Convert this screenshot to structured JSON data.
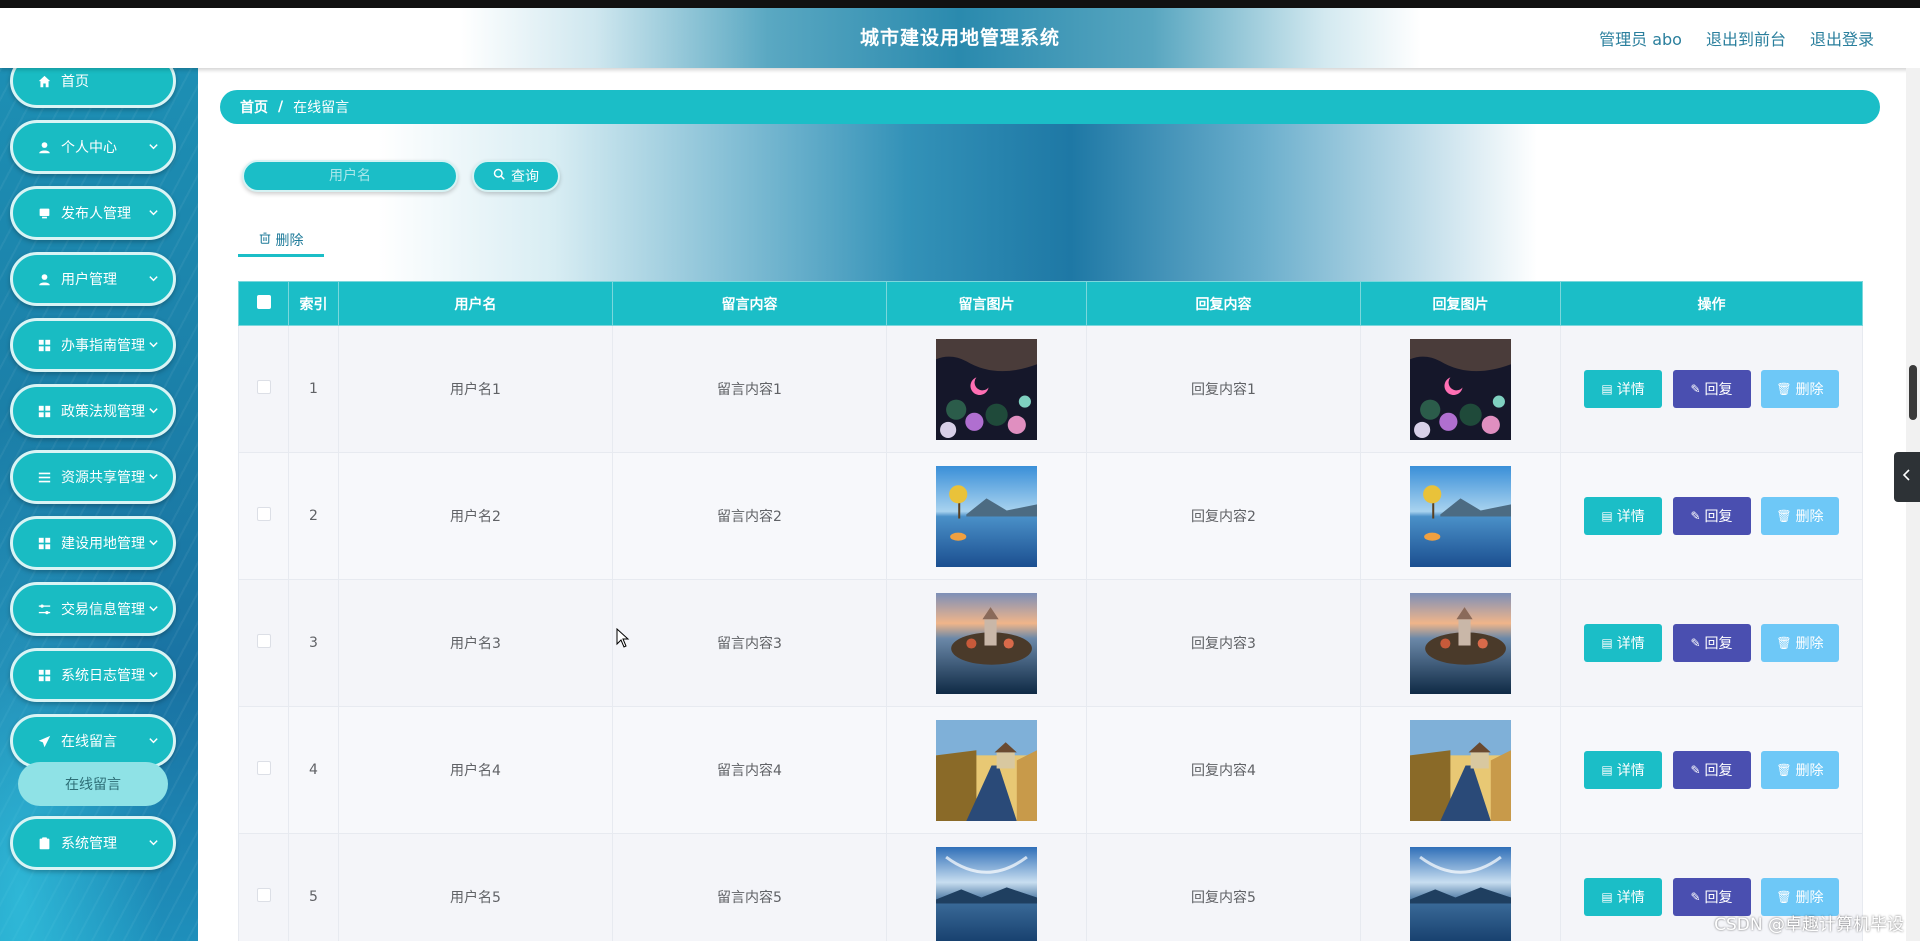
{
  "app": {
    "title": "城市建设用地管理系统",
    "header_links": [
      "管理员 abo",
      "退出到前台",
      "退出登录"
    ]
  },
  "sidebar": {
    "items": [
      {
        "label": "首页",
        "icon": "home-icon",
        "has_children": false
      },
      {
        "label": "个人中心",
        "icon": "user-icon",
        "has_children": true
      },
      {
        "label": "发布人管理",
        "icon": "monitor-icon",
        "has_children": true
      },
      {
        "label": "用户管理",
        "icon": "user-icon",
        "has_children": true
      },
      {
        "label": "办事指南管理",
        "icon": "grid-icon",
        "has_children": true
      },
      {
        "label": "政策法规管理",
        "icon": "grid-icon",
        "has_children": true
      },
      {
        "label": "资源共享管理",
        "icon": "list-icon",
        "has_children": true
      },
      {
        "label": "建设用地管理",
        "icon": "grid-icon",
        "has_children": true
      },
      {
        "label": "交易信息管理",
        "icon": "sliders-icon",
        "has_children": true
      },
      {
        "label": "系统日志管理",
        "icon": "grid-icon",
        "has_children": true
      },
      {
        "label": "在线留言",
        "icon": "send-icon",
        "has_children": true
      },
      {
        "label": "系统管理",
        "icon": "clipboard-icon",
        "has_children": true
      }
    ],
    "active_submenu": "在线留言"
  },
  "breadcrumb": {
    "home": "首页",
    "separator": "/",
    "current": "在线留言"
  },
  "search": {
    "placeholder": "用户名",
    "query_label": "查询"
  },
  "toolbar": {
    "delete_label": "删除"
  },
  "table": {
    "columns": [
      "索引",
      "用户名",
      "留言内容",
      "留言图片",
      "回复内容",
      "回复图片",
      "操作"
    ],
    "rows": [
      {
        "index": "1",
        "username": "用户名1",
        "message": "留言内容1",
        "reply": "回复内容1",
        "image": "night-moon-flowers"
      },
      {
        "index": "2",
        "username": "用户名2",
        "message": "留言内容2",
        "reply": "回复内容2",
        "image": "lake-tree"
      },
      {
        "index": "3",
        "username": "用户名3",
        "message": "留言内容3",
        "reply": "回复内容3",
        "image": "lake-island-castle"
      },
      {
        "index": "4",
        "username": "用户名4",
        "message": "留言内容4",
        "reply": "回复内容4",
        "image": "road-house"
      },
      {
        "index": "5",
        "username": "用户名5",
        "message": "留言内容5",
        "reply": "回复内容5",
        "image": "sky-lake"
      }
    ],
    "actions": {
      "detail": "详情",
      "reply": "回复",
      "delete": "删除"
    }
  },
  "watermark": "CSDN @卓趣计算机毕设",
  "colors": {
    "accent": "#1bbec7",
    "reply_button": "#4a4fb0",
    "delete_button": "#6ec8f7",
    "header_link": "#2a7f9d"
  }
}
